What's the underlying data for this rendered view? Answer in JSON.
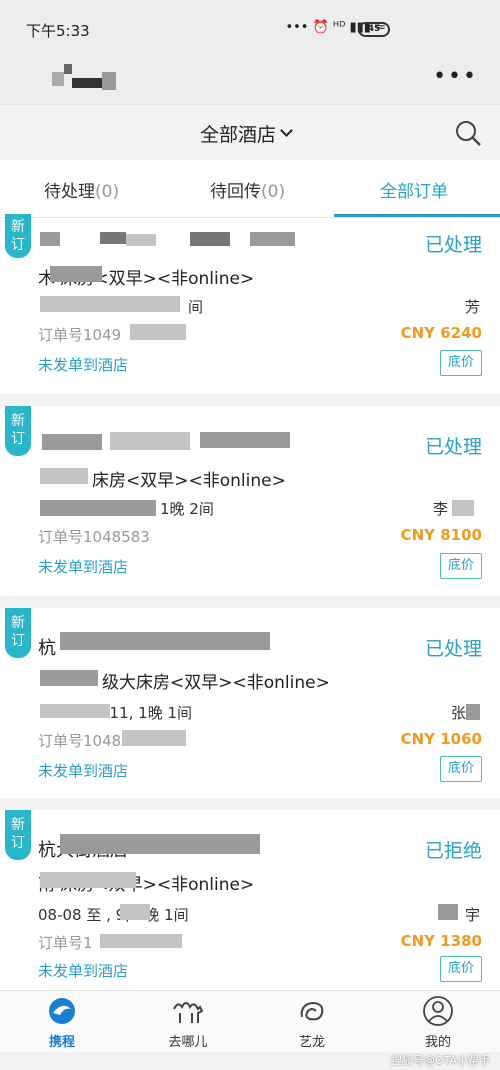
{
  "status_bar": {
    "time": "下午5:33",
    "icons_text": "••• ⏰ ᴴᴰ ▮▮▮ ≈",
    "battery": "45"
  },
  "header": {
    "more": "•••"
  },
  "title_bar": {
    "hotel_selector": "全部酒店"
  },
  "tabs": [
    {
      "label": "待处理",
      "count": "(0)"
    },
    {
      "label": "待回传",
      "count": "(0)"
    },
    {
      "label": "全部订单",
      "count": ""
    }
  ],
  "orders": [
    {
      "badge": "新\n订",
      "hotel_name": "",
      "status": "已处理",
      "room": "木 床房<双早><非online>",
      "stay": "间",
      "guest": "芳",
      "order_no": "订单号1049",
      "price": "CNY 6240",
      "send_status": "未发单到酒店",
      "tag": "底价"
    },
    {
      "badge": "新\n订",
      "hotel_name": "",
      "status": "已处理",
      "room": "床房<双早><非online>",
      "stay": "1晚 2间",
      "guest": "李",
      "order_no": "订单号1048583",
      "price": "CNY 8100",
      "send_status": "未发单到酒店",
      "tag": "底价"
    },
    {
      "badge": "新\n订",
      "hotel_name": "杭",
      "status": "已处理",
      "room": "级大床房<双早><非online>",
      "stay": ". 11, 1晚 1间",
      "guest": "张",
      "order_no": "订单号1048",
      "price": "CNY 1060",
      "send_status": "未发单到酒店",
      "tag": "底价"
    },
    {
      "badge": "新\n订",
      "hotel_name": "杭大街酒店",
      "status": "已拒绝",
      "room": "南 床房<双早><非online>",
      "stay": "08-08 至 , 9, 1晚 1间",
      "guest": "宇",
      "order_no": "订单号1",
      "price": "CNY 1380",
      "send_status": "未发单到酒店",
      "tag": "底价"
    }
  ],
  "bottom_tabs": [
    {
      "label": "携程",
      "icon": "dolphin-icon"
    },
    {
      "label": "去哪儿",
      "icon": "camel-icon"
    },
    {
      "label": "艺龙",
      "icon": "dragon-icon"
    },
    {
      "label": "我的",
      "icon": "user-icon"
    }
  ],
  "watermark": "搜狐号@OTA小帮手",
  "colors": {
    "accent": "#2aa0c8",
    "price": "#f09a22",
    "badge": "#29b6c8"
  }
}
